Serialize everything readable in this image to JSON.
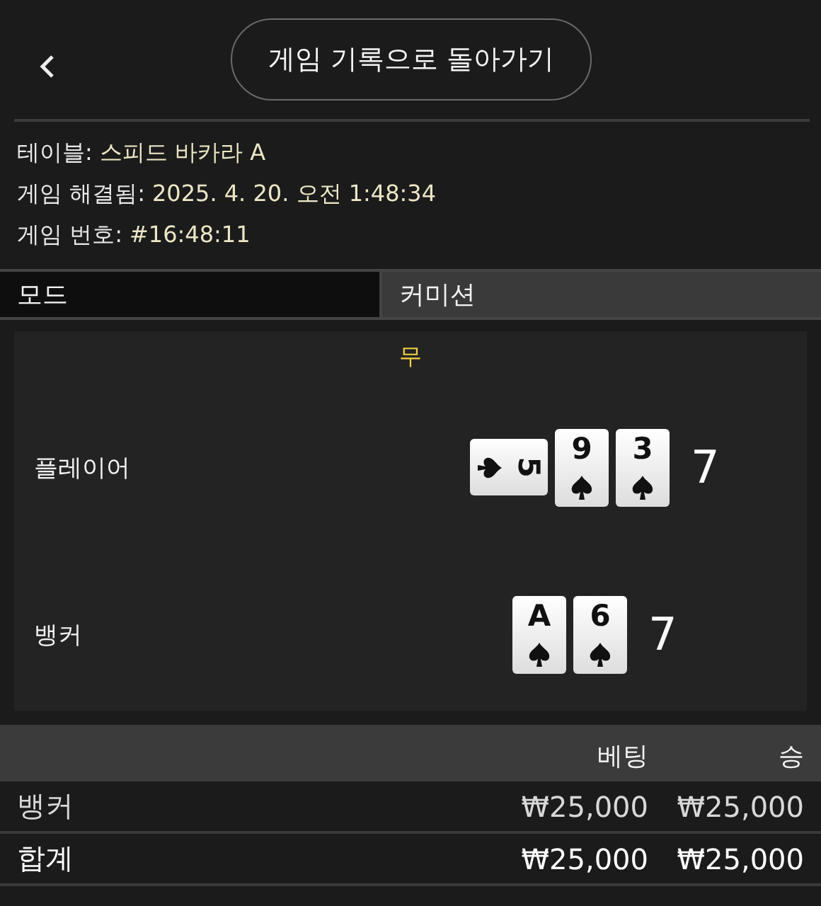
{
  "header": {
    "back_label": "게임 기록으로 돌아가기"
  },
  "info": [
    {
      "label": "테이블:",
      "value": "스피드 바카라 A"
    },
    {
      "label": "게임 해결됨:",
      "value": "2025. 4. 20. 오전 1:48:34"
    },
    {
      "label": "게임 번호:",
      "value": "#16:48:11"
    }
  ],
  "tabs": [
    {
      "label": "모드",
      "selected": true
    },
    {
      "label": "커미션",
      "selected": false
    }
  ],
  "result": {
    "outcome": "무",
    "hands": [
      {
        "name": "플레이어",
        "score": "7",
        "cards": [
          {
            "rank": "5",
            "kind": "spade",
            "rotated": true
          },
          {
            "rank": "9",
            "kind": "spade",
            "rotated": false
          },
          {
            "rank": "3",
            "kind": "spade",
            "rotated": false
          }
        ]
      },
      {
        "name": "뱅커",
        "score": "7",
        "cards": [
          {
            "rank": "A",
            "kind": "spade",
            "rotated": false
          },
          {
            "rank": "6",
            "kind": "spade",
            "rotated": false
          }
        ]
      }
    ]
  },
  "bets": {
    "columns": [
      "베팅",
      "승"
    ],
    "rows": [
      {
        "label": "뱅커",
        "bet": "₩25,000",
        "win": "₩25,000",
        "kind": "bet"
      },
      {
        "label": "합계",
        "bet": "₩25,000",
        "win": "₩25,000",
        "kind": "total"
      }
    ]
  }
}
